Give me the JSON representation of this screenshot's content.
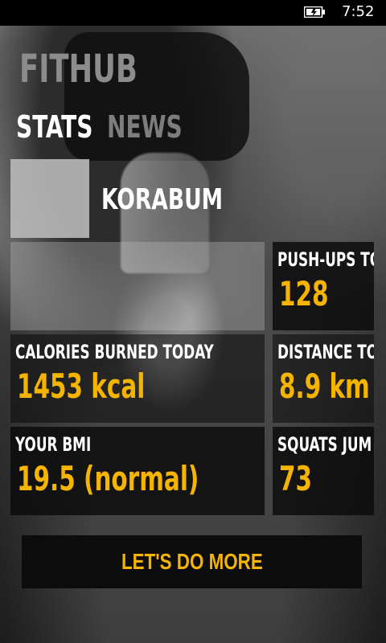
{
  "status_bar": {
    "time": "7:52",
    "battery_icon": "battery-charging-icon"
  },
  "app": {
    "title": "FITHUB"
  },
  "tabs": [
    {
      "label": "STATS",
      "active": true
    },
    {
      "label": "NEWS",
      "active": false
    }
  ],
  "profile": {
    "username": "KORABUM"
  },
  "tiles": {
    "pushups": {
      "label": "PUSH-UPS TO",
      "value": "128"
    },
    "calories": {
      "label": "CALORIES BURNED TODAY",
      "value": "1453 kcal"
    },
    "distance": {
      "label": "DISTANCE TO",
      "value": "8.9 km"
    },
    "bmi": {
      "label": "YOUR BMI",
      "value": "19.5 (normal)"
    },
    "squats": {
      "label": "SQUATS JUM",
      "value": "73"
    }
  },
  "cta": {
    "label": "LET'S DO MORE"
  },
  "colors": {
    "accent": "#f5b400",
    "tile_background": "#0a0a0a",
    "title_gray": "#8c8c8c"
  }
}
